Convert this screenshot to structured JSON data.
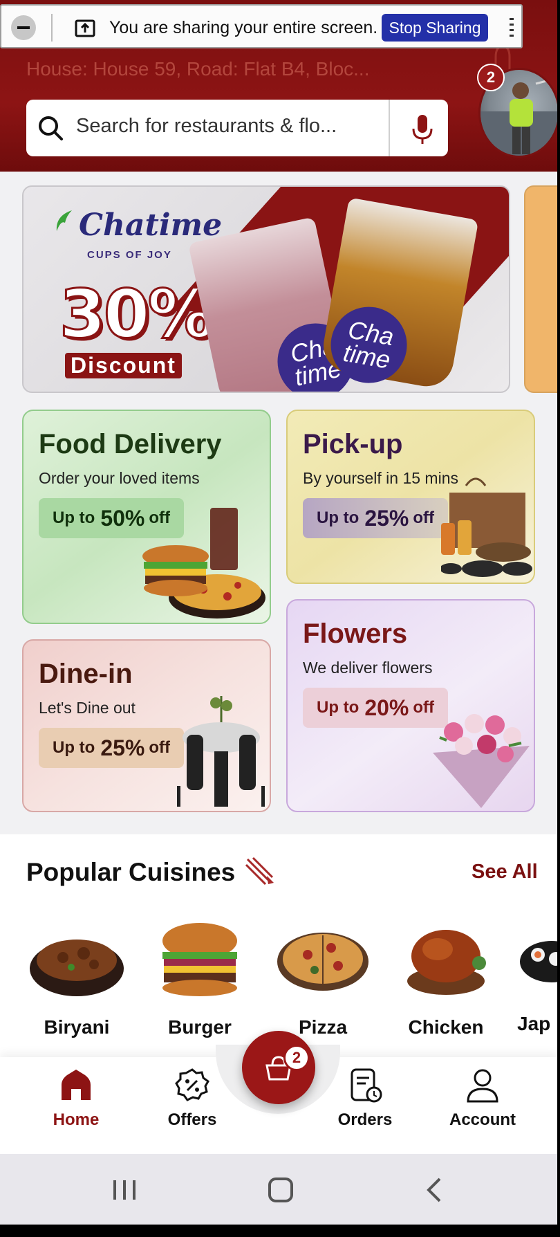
{
  "share_bar": {
    "message": "You are sharing your entire screen.",
    "stop_label": "Stop Sharing"
  },
  "header": {
    "address": "House: House 59, Road: Flat B4, Bloc...",
    "notification_count": "2",
    "search_placeholder": "Search for restaurants & flo..."
  },
  "banner": {
    "brand": "Chatime",
    "tagline": "CUPS OF JOY",
    "discount_percent": "30%",
    "discount_word": "Discount",
    "cup_text": "Cha time"
  },
  "services": [
    {
      "title": "Food Delivery",
      "subtitle": "Order your loved items",
      "pill_prefix": "Up to",
      "pill_value": "50%",
      "pill_suffix": "off"
    },
    {
      "title": "Pick-up",
      "subtitle": "By yourself in 15 mins",
      "pill_prefix": "Up to",
      "pill_value": "25%",
      "pill_suffix": "off"
    },
    {
      "title": "Dine-in",
      "subtitle": "Let's Dine out",
      "pill_prefix": "Up to",
      "pill_value": "25%",
      "pill_suffix": "off"
    },
    {
      "title": "Flowers",
      "subtitle": "We deliver flowers",
      "pill_prefix": "Up to",
      "pill_value": "20%",
      "pill_suffix": "off"
    }
  ],
  "popular": {
    "title": "Popular Cuisines",
    "see_all": "See All",
    "items": [
      {
        "label": "Biryani"
      },
      {
        "label": "Burger"
      },
      {
        "label": "Pizza"
      },
      {
        "label": "Chicken"
      },
      {
        "label": "Jap"
      }
    ]
  },
  "cart": {
    "count": "2"
  },
  "nav": {
    "items": [
      {
        "label": "Home",
        "active": true
      },
      {
        "label": "Offers",
        "active": false
      },
      {
        "label": "Orders",
        "active": false
      },
      {
        "label": "Account",
        "active": false
      }
    ]
  },
  "colors": {
    "brand_red": "#8d1414",
    "active_nav": "#8d1414",
    "stop_button": "#2330a8"
  }
}
